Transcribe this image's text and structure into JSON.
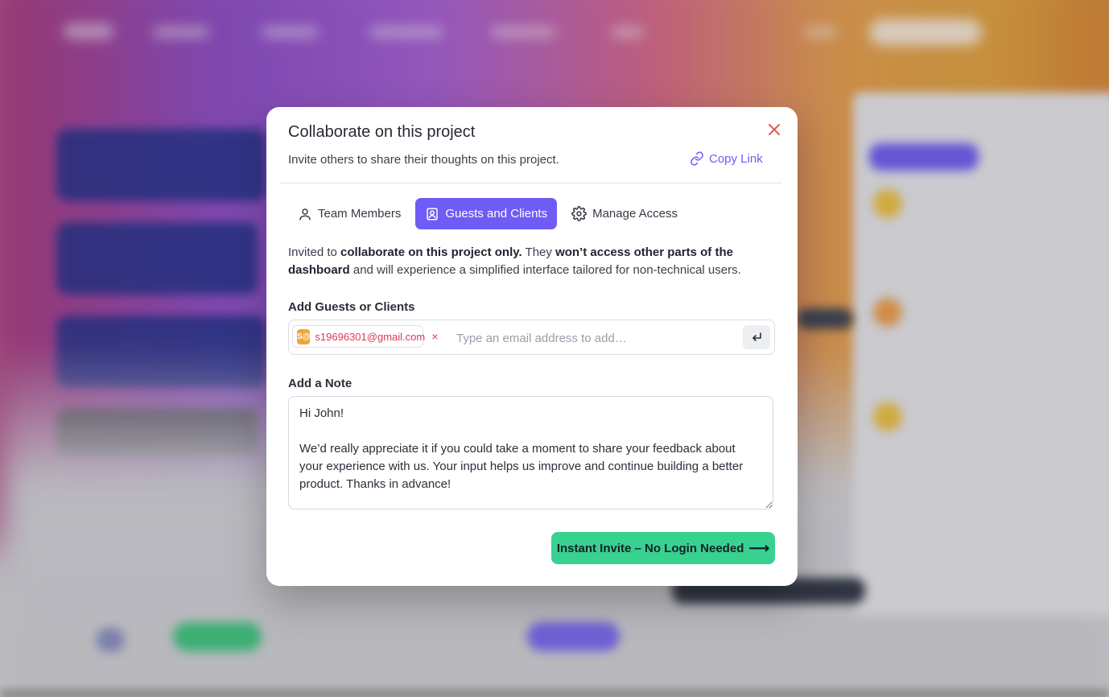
{
  "modal": {
    "title": "Collaborate on this project",
    "subtitle": "Invite others to share their thoughts on this project.",
    "copy_link_label": "Copy Link",
    "close_icon": "close-icon"
  },
  "tabs": [
    {
      "label": "Team Members",
      "icon": "user-icon",
      "active": false
    },
    {
      "label": "Guests and Clients",
      "icon": "contact-card-icon",
      "active": true
    },
    {
      "label": "Manage Access",
      "icon": "gear-icon",
      "active": false
    }
  ],
  "description": {
    "part1": "Invited to ",
    "bold1": "collaborate on this project only.",
    "part2": " They ",
    "bold2": "won’t access other parts of the dashboard",
    "part3": " and will experience a simplified interface tailored for non-technical users."
  },
  "guests": {
    "label": "Add Guests or Clients",
    "chips": [
      {
        "avatar_text": "S@",
        "email": "s19696301@gmail.com",
        "remove": "×"
      }
    ],
    "input_placeholder": "Type an email address to add…",
    "input_value": "",
    "enter_icon": "enter-icon"
  },
  "note": {
    "label": "Add a Note",
    "value": "Hi John!\n\nWe’d really appreciate it if you could take a moment to share your feedback about your experience with us. Your input helps us improve and continue building a better product. Thanks in advance!"
  },
  "submit": {
    "label": "Instant Invite – No Login Needed",
    "arrow": "⟶"
  },
  "colors": {
    "accent": "#6e5cf4",
    "success": "#38d18f",
    "danger": "#e05a5a",
    "chip_text": "#d83a5a"
  }
}
